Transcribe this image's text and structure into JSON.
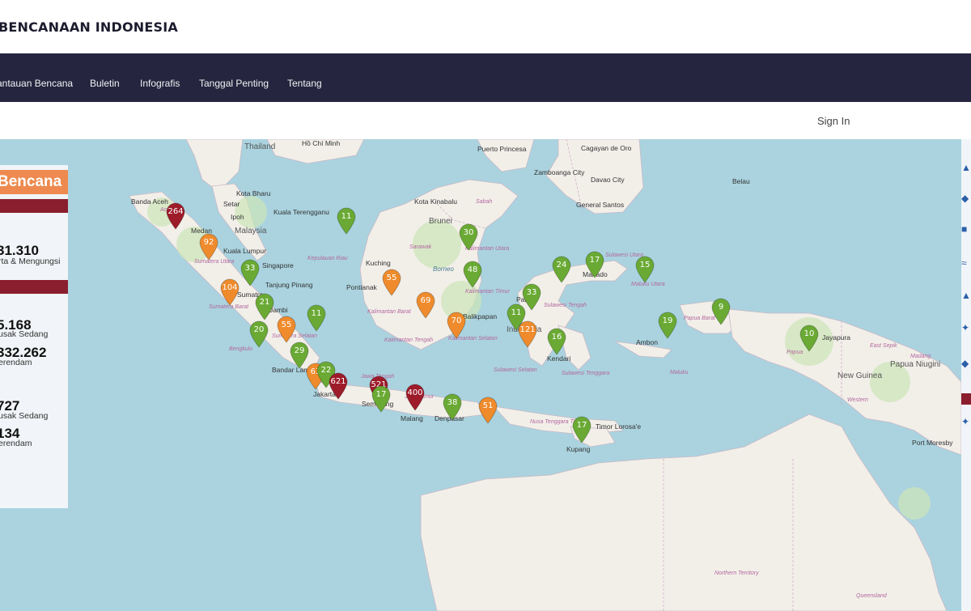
{
  "header": {
    "brand": "BENCANAAN INDONESIA"
  },
  "nav": {
    "items": [
      "antauan Bencana",
      "Buletin",
      "Infografis",
      "Tanggal Penting",
      "Tentang"
    ]
  },
  "signin": "Sign In",
  "panel": {
    "title": "Bencana",
    "stat1_value": "31.310",
    "stat1_label": "rta & Mengungsi",
    "stat2_value": "5.168",
    "stat2_label": "usak Sedang",
    "stat3_value": "332.262",
    "stat3_label": "erendam",
    "stat4_value": "727",
    "stat4_label": "usak Sedang",
    "stat5_value": "134",
    "stat5_label": "erendam"
  },
  "map": {
    "labels": [
      "Thailand",
      "Hồ Chí Minh",
      "Puerto Princesa",
      "Cagayan de Oro",
      "Zamboanga City",
      "Davao City",
      "Belau",
      "Banda Aceh",
      "Kota Bharu",
      "Setar",
      "Ipoh",
      "Malaysia",
      "Kuala Terengganu",
      "Kota Kinabalu",
      "Sabah",
      "General Santos",
      "Brunei",
      "Medan",
      "Kuala Lumpur",
      "Singapore",
      "Kepulauan Riau",
      "Kuching",
      "Borneo",
      "Sarawak",
      "Pontianak",
      "Tanjung Pinang",
      "Sumatra",
      "Jambi",
      "Bengkulu",
      "Balikpapan",
      "Palu",
      "Indonesia",
      "Kendari",
      "Manado",
      "Ambon",
      "Maluku",
      "Papua Barat",
      "Jayapura",
      "Papua",
      "New Guinea",
      "Papua Niugini",
      "East Sepik",
      "Madang",
      "Western",
      "Port Moresby",
      "Bandar Lampung",
      "Jakarta",
      "Semarang",
      "Malang",
      "Denpasar",
      "Kupang",
      "Timor Lorosa'e",
      "Nusa Tenggara Timur",
      "Northern Territory",
      "Queensland",
      "Aceh",
      "Sumatera Utara",
      "Sumatera Barat",
      "Sumatera Selatan",
      "Kalimantan Barat",
      "Kalimantan Tengah",
      "Kalimantan Selatan",
      "Kalimantan Timur",
      "Kalimantan Utara",
      "Sulawesi Tengah",
      "Sulawesi Selatan",
      "Sulawesi Tenggara",
      "Sulawesi Utara",
      "Maluku Utara",
      "Jawa Tengah",
      "Jawa Timur"
    ],
    "markers": [
      {
        "count": "264",
        "level": "high"
      },
      {
        "count": "92",
        "level": "mid"
      },
      {
        "count": "33",
        "level": "low"
      },
      {
        "count": "104",
        "level": "mid"
      },
      {
        "count": "21",
        "level": "low"
      },
      {
        "count": "20",
        "level": "low"
      },
      {
        "count": "55",
        "level": "mid"
      },
      {
        "count": "11",
        "level": "low"
      },
      {
        "count": "29",
        "level": "low"
      },
      {
        "count": "63",
        "level": "mid"
      },
      {
        "count": "22",
        "level": "low"
      },
      {
        "count": "621",
        "level": "high"
      },
      {
        "count": "521",
        "level": "high"
      },
      {
        "count": "17",
        "level": "low"
      },
      {
        "count": "400",
        "level": "high"
      },
      {
        "count": "38",
        "level": "low"
      },
      {
        "count": "51",
        "level": "mid"
      },
      {
        "count": "11",
        "level": "low"
      },
      {
        "count": "30",
        "level": "low"
      },
      {
        "count": "55",
        "level": "mid"
      },
      {
        "count": "48",
        "level": "low"
      },
      {
        "count": "69",
        "level": "mid"
      },
      {
        "count": "70",
        "level": "mid"
      },
      {
        "count": "33",
        "level": "low"
      },
      {
        "count": "11",
        "level": "low"
      },
      {
        "count": "121",
        "level": "mid"
      },
      {
        "count": "16",
        "level": "low"
      },
      {
        "count": "24",
        "level": "low"
      },
      {
        "count": "17",
        "level": "low"
      },
      {
        "count": "15",
        "level": "low"
      },
      {
        "count": "19",
        "level": "low"
      },
      {
        "count": "9",
        "level": "low"
      },
      {
        "count": "10",
        "level": "low"
      },
      {
        "count": "17",
        "level": "low"
      }
    ],
    "colors": {
      "high": "#9e1b2a",
      "mid": "#ef8b2c",
      "low": "#6aaa34",
      "water": "#aad3df",
      "land": "#f2efe9"
    }
  }
}
